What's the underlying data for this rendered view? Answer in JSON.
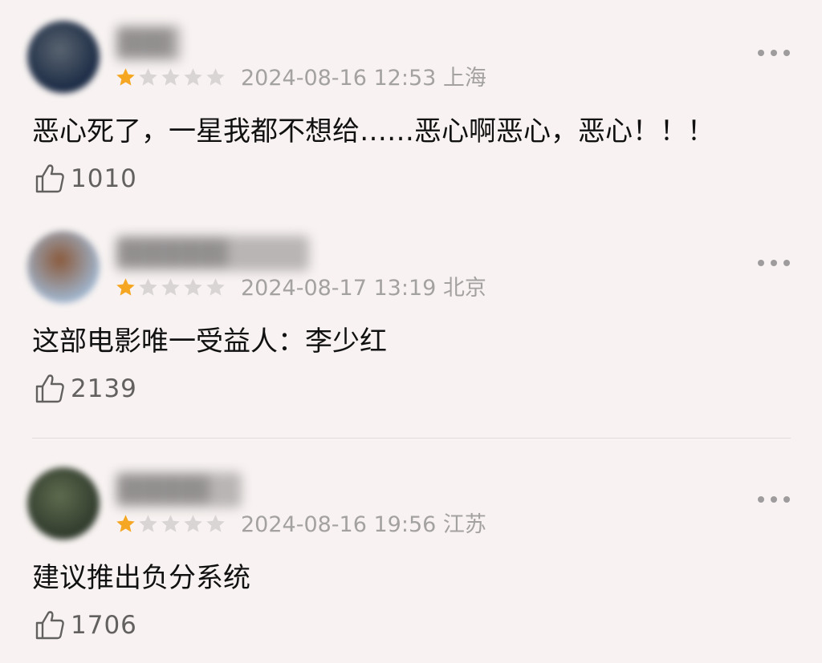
{
  "comments": [
    {
      "username": "███",
      "rating": 1,
      "max_rating": 5,
      "date_location": "2024-08-16 12:53 上海",
      "text": "恶心死了，一星我都不想给……恶心啊恶心，恶心！！！",
      "likes": "1010",
      "avatar_colors": [
        "#1a2a44",
        "#5a6470"
      ]
    },
    {
      "username": "██████",
      "rating": 1,
      "max_rating": 5,
      "date_location": "2024-08-17 13:19 北京",
      "text": "这部电影唯一受益人：李少红",
      "likes": "2139",
      "avatar_colors": [
        "#9fb4cc",
        "#8a5a3c"
      ]
    },
    {
      "username": "█████",
      "rating": 1,
      "max_rating": 5,
      "date_location": "2024-08-16 19:56 江苏",
      "text": "建议推出负分系统",
      "likes": "1706",
      "avatar_colors": [
        "#2f3a2c",
        "#5f6b4e"
      ]
    }
  ],
  "colors": {
    "background": "#f8f3f2",
    "star_filled": "#f5a623",
    "star_empty": "#d8d5d4",
    "meta_text": "#a4a1a1",
    "like_text": "#636060"
  },
  "icons": {
    "rating": "star-icon",
    "more": "more-dots-icon",
    "like": "thumbs-up-icon"
  }
}
